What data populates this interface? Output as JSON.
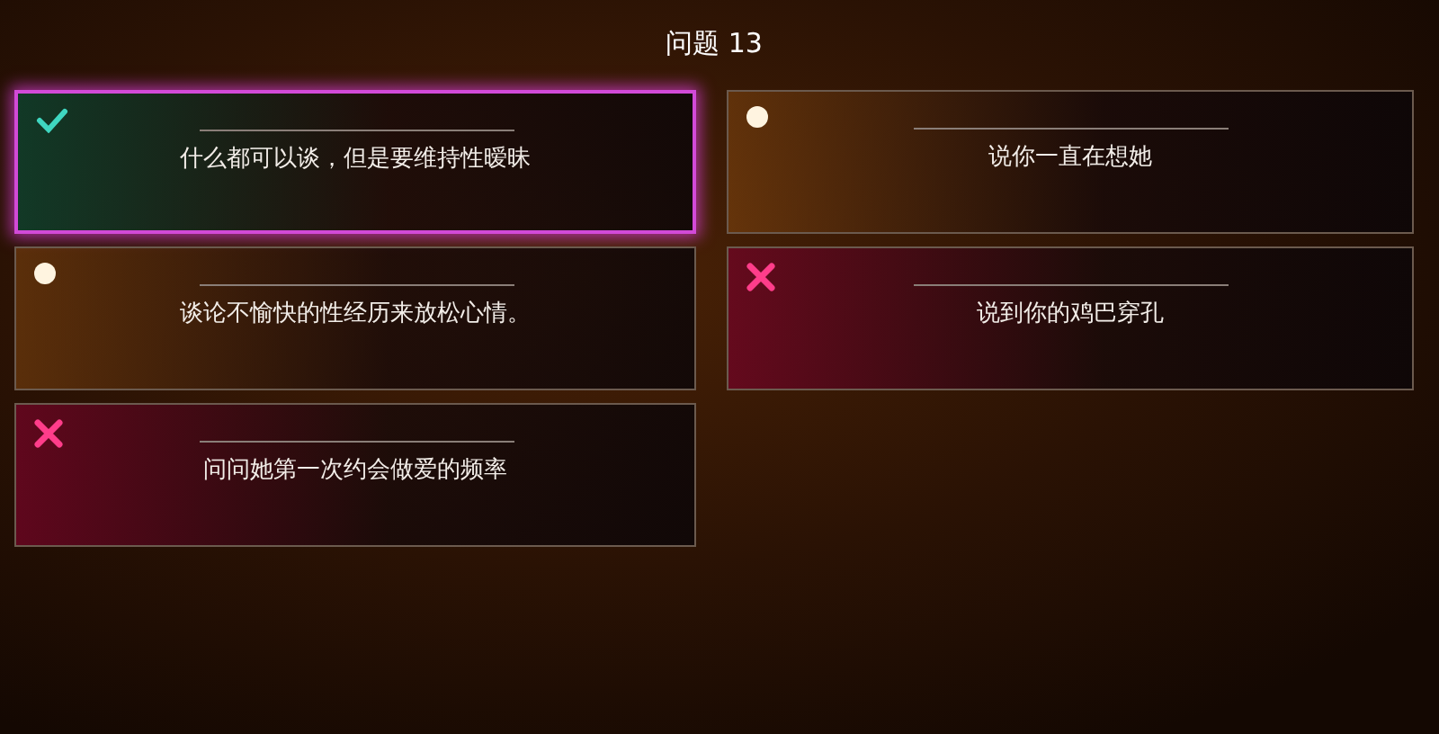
{
  "title": "问题 13",
  "options": [
    {
      "text": "什么都可以谈，但是要维持性暧昧",
      "kind": "correct",
      "selected": true
    },
    {
      "text": "说你一直在想她",
      "kind": "neutral",
      "selected": false
    },
    {
      "text": "谈论不愉快的性经历来放松心情。",
      "kind": "neutral",
      "selected": false
    },
    {
      "text": "说到你的鸡巴穿孔",
      "kind": "wrong",
      "selected": false
    },
    {
      "text": "问问她第一次约会做爱的频率",
      "kind": "wrong",
      "selected": false
    }
  ]
}
